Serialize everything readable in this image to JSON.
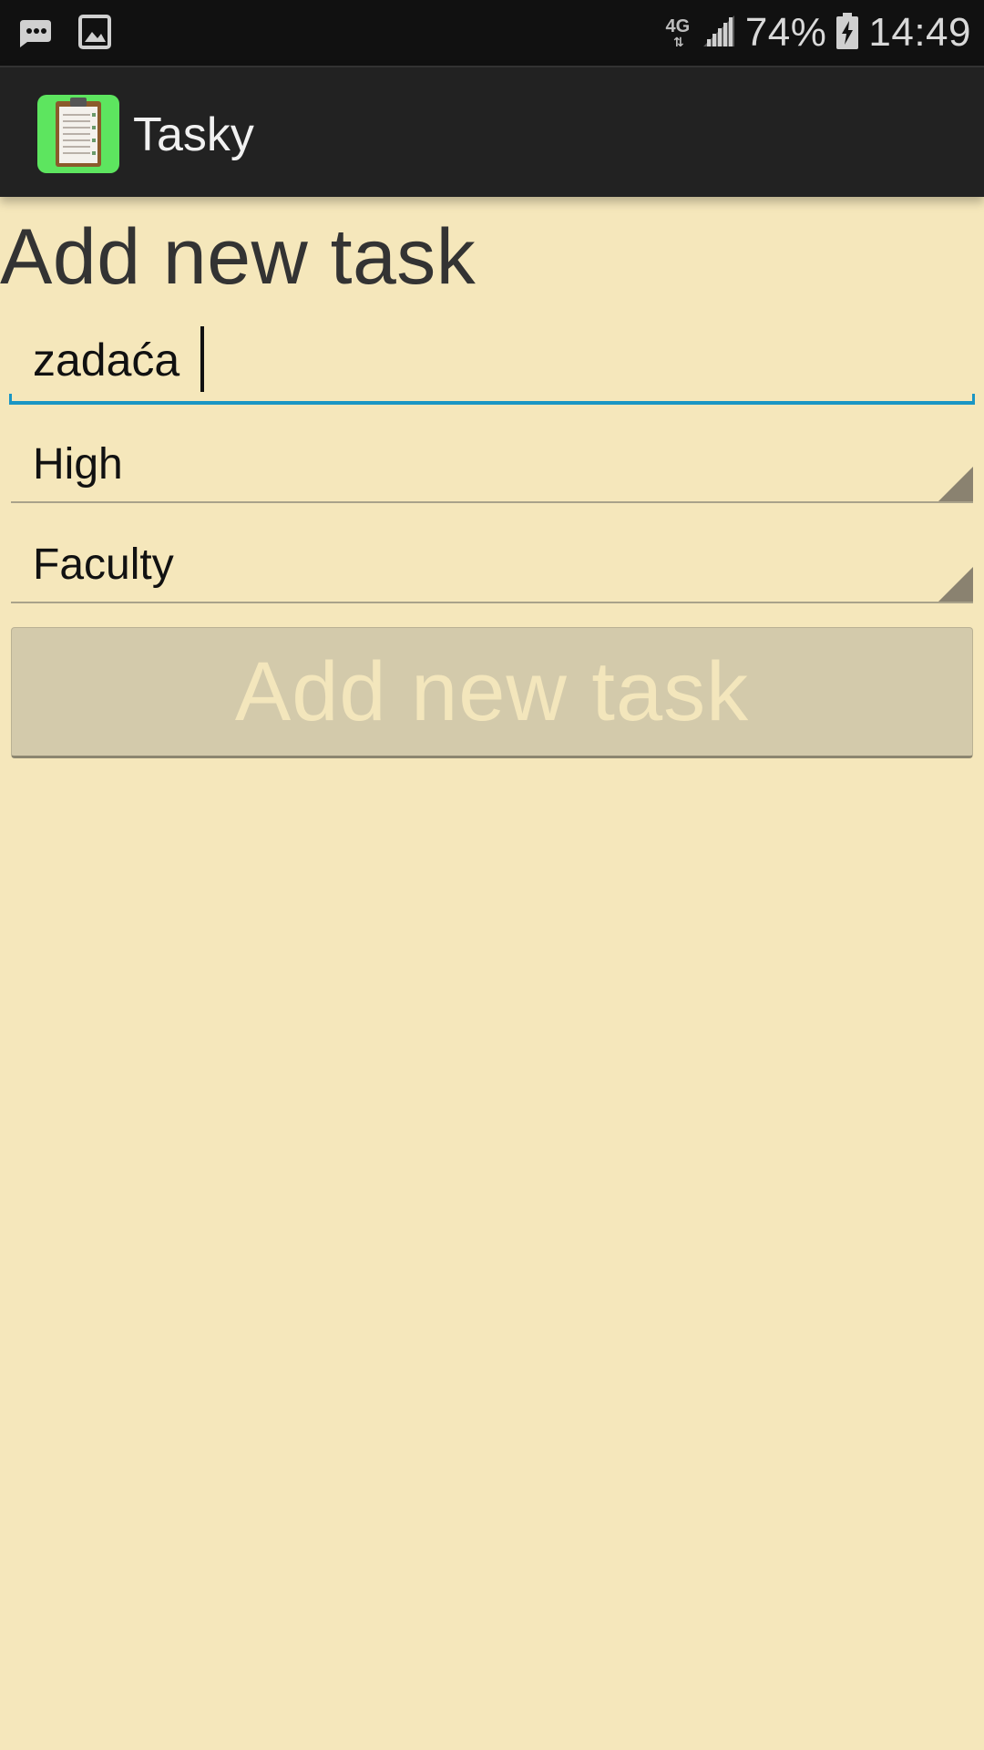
{
  "status_bar": {
    "network_type": "4G",
    "battery_percent": "74%",
    "time": "14:49",
    "icons": [
      "messenger-icon",
      "gallery-icon",
      "network-4g-icon",
      "signal-icon",
      "battery-charging-icon"
    ]
  },
  "action_bar": {
    "app_title": "Tasky",
    "app_icon": "clipboard-icon",
    "app_icon_color": "#5de55f"
  },
  "form": {
    "heading": "Add new task",
    "task_name_value": "zadaća",
    "priority_value": "High",
    "category_value": "Faculty",
    "submit_label": "Add new task"
  },
  "colors": {
    "background": "#f5e7bb",
    "accent": "#1a96c4",
    "action_bar": "#222222",
    "button": "#d3caab"
  }
}
